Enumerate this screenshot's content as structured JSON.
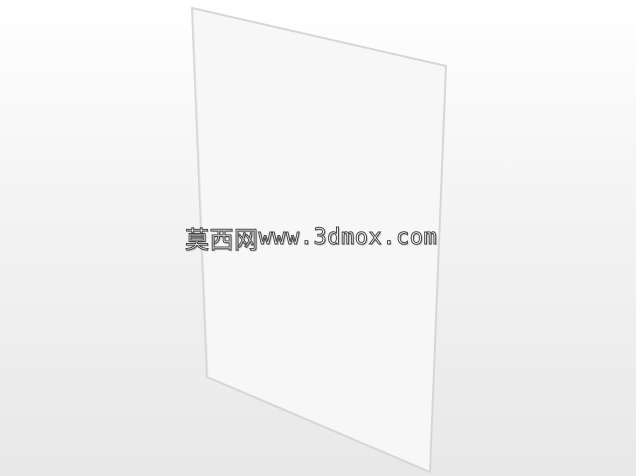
{
  "viewport": {
    "background_top": "#ffffff",
    "background_bottom": "#e8e8e8"
  },
  "panel": {
    "type": "thin glass/acrylic sheet",
    "fill": "#f7f7f7",
    "stroke": "#d6d6d6"
  },
  "watermark": {
    "text_cjk": "莫西网",
    "text_url": "www.3dmox.com"
  }
}
